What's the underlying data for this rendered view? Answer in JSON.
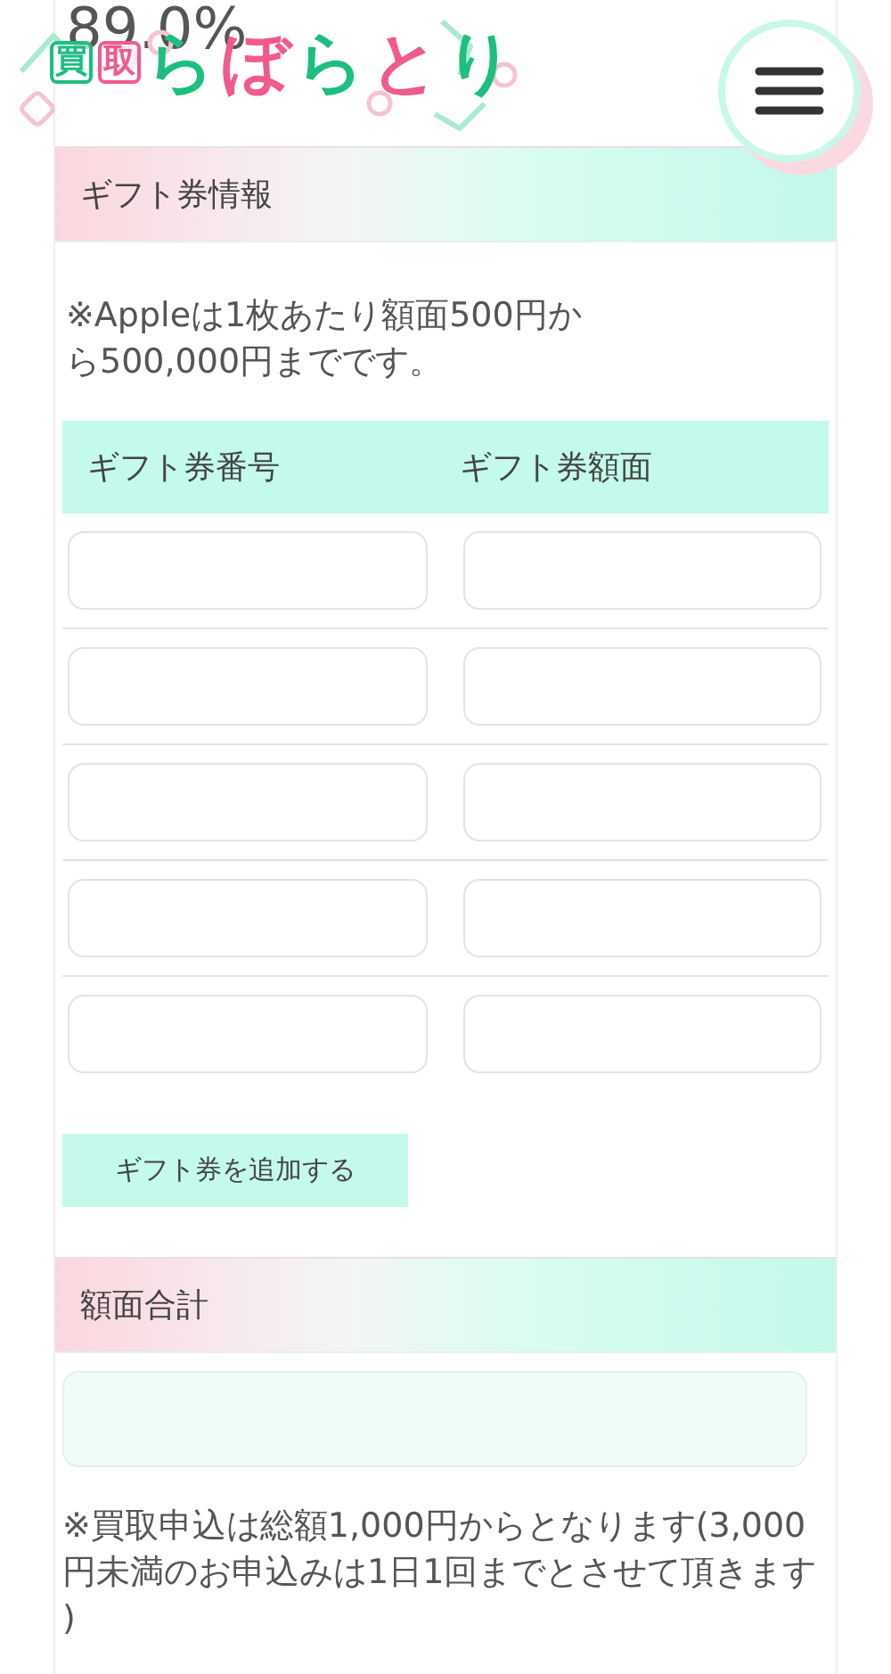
{
  "rate": "89.0%",
  "logo": {
    "prefix": "買取",
    "name": "らぼらとり"
  },
  "gift_section": {
    "title": "ギフト券情報",
    "note": "※Appleは1枚あたり額面500円から500,000円までです。",
    "columns": [
      "ギフト券番号",
      "ギフト券額面"
    ],
    "rows": [
      {
        "kind": "entry"
      },
      {
        "kind": "entry"
      },
      {
        "kind": "entry"
      },
      {
        "kind": "entry"
      },
      {
        "kind": "entry"
      }
    ],
    "add_button": "ギフト券を追加する"
  },
  "total_section": {
    "title": "額面合計",
    "note": "※買取申込は総額1,000円からとなります(3,000円未満のお申込みは1日1回までとさせて頂きます )"
  }
}
